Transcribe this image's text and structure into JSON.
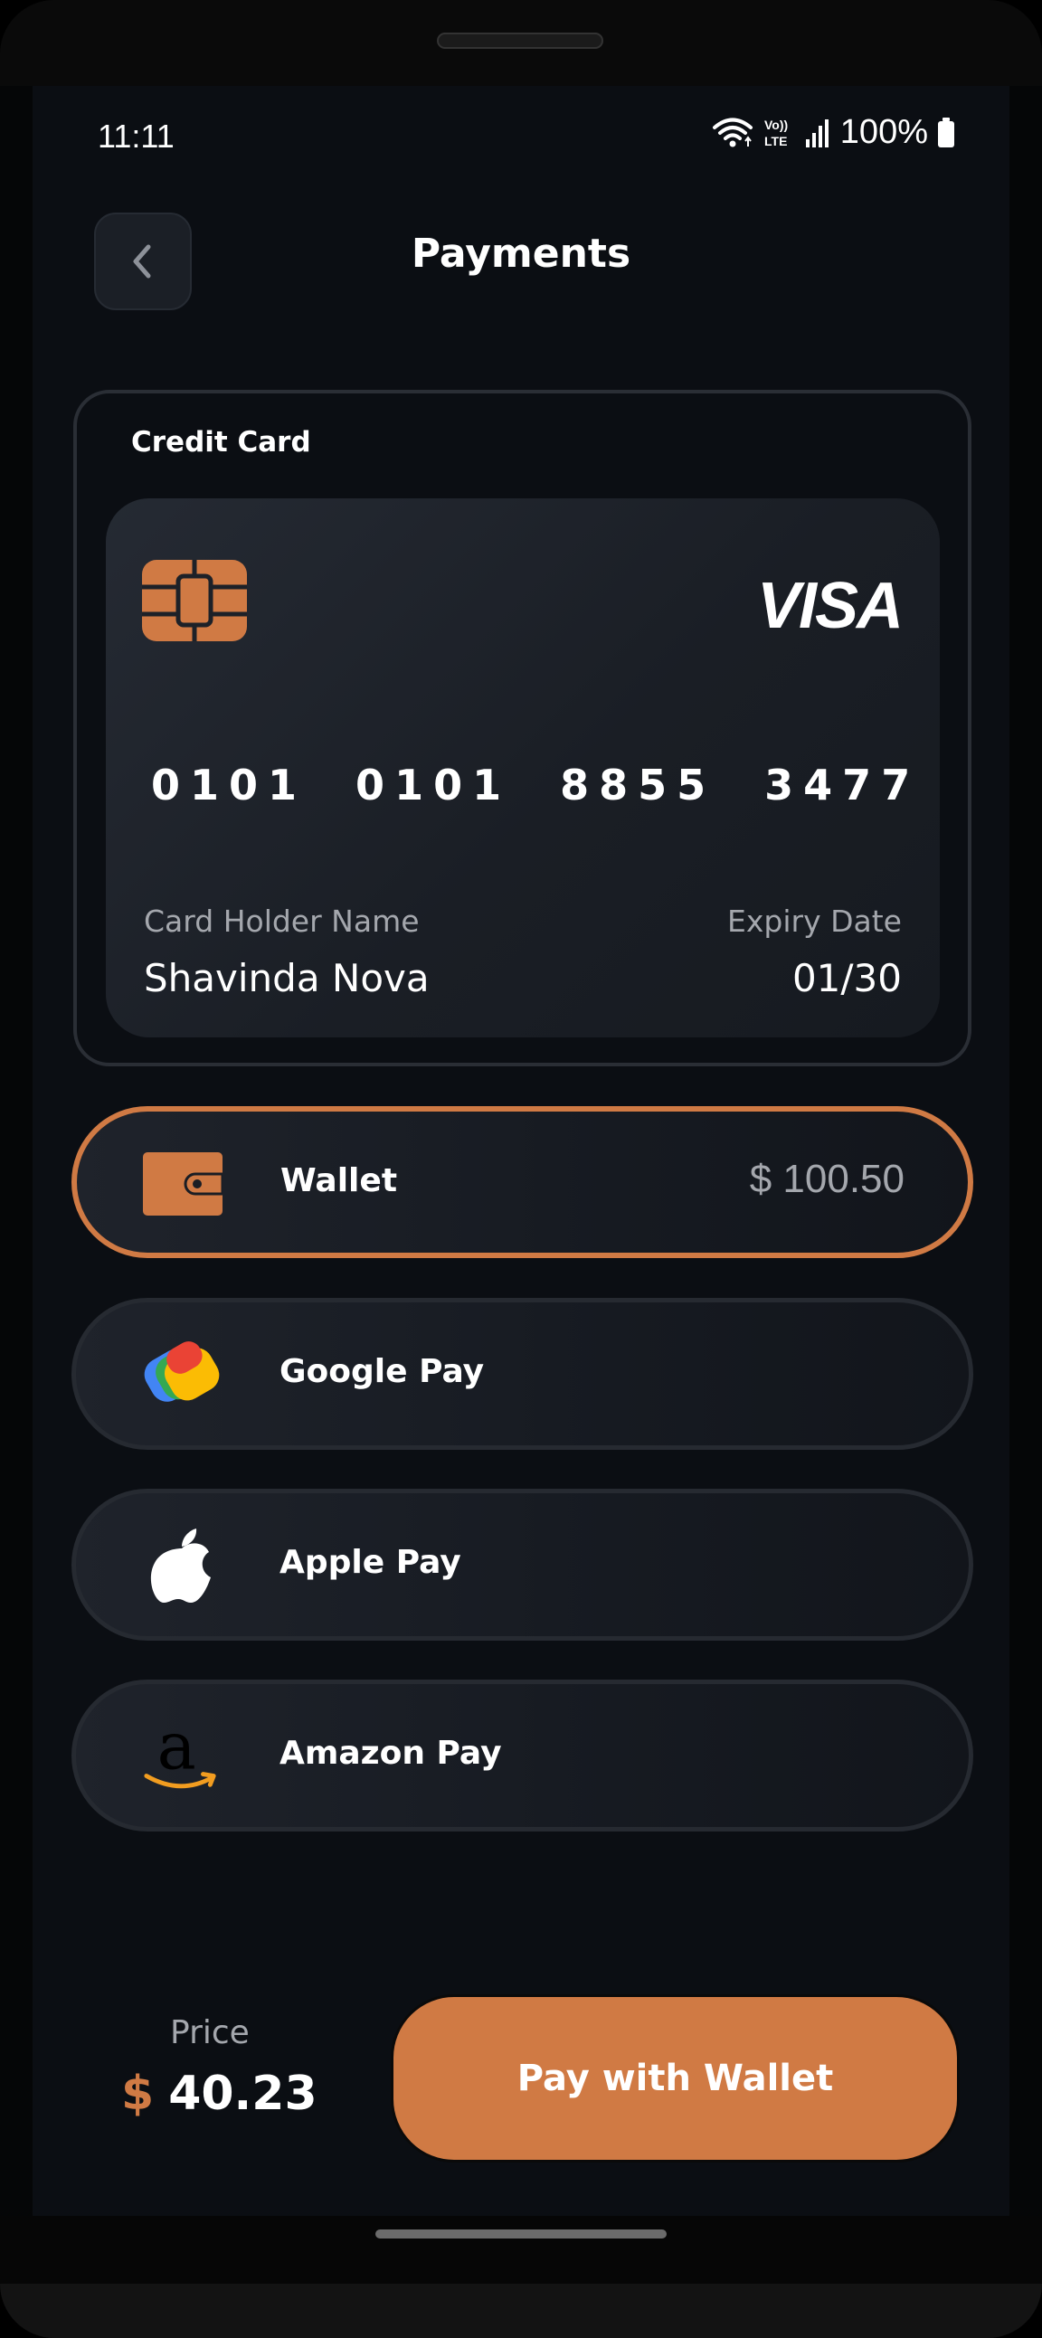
{
  "status_bar": {
    "time": "11:11",
    "volte": "Vo)) LTE",
    "battery": "100%",
    "icons": [
      "wifi-icon",
      "volte-icon",
      "signal-icon",
      "battery-icon"
    ]
  },
  "header": {
    "title": "Payments",
    "back_icon": "chevron-left-icon"
  },
  "credit_card": {
    "section_label": "Credit Card",
    "brand": "VISA",
    "number": "0101  0101  8855  3477",
    "holder_label": "Card Holder Name",
    "holder_name": "Shavinda Nova",
    "expiry_label": "Expiry Date",
    "expiry_value": "01/30"
  },
  "payment_options": [
    {
      "label": "Wallet",
      "amount": "$ 100.50",
      "icon": "wallet-icon",
      "selected": true
    },
    {
      "label": "Google Pay",
      "icon": "google-pay-icon",
      "selected": false
    },
    {
      "label": "Apple Pay",
      "icon": "apple-icon",
      "selected": false
    },
    {
      "label": "Amazon Pay",
      "icon": "amazon-icon",
      "selected": false
    }
  ],
  "checkout": {
    "price_label": "Price",
    "currency": "$",
    "price": "40.23",
    "pay_button": "Pay with Wallet"
  },
  "colors": {
    "accent": "#d07a44",
    "background": "#0b0e13",
    "card": "#1f232b",
    "muted_text": "#a4a7ad"
  }
}
